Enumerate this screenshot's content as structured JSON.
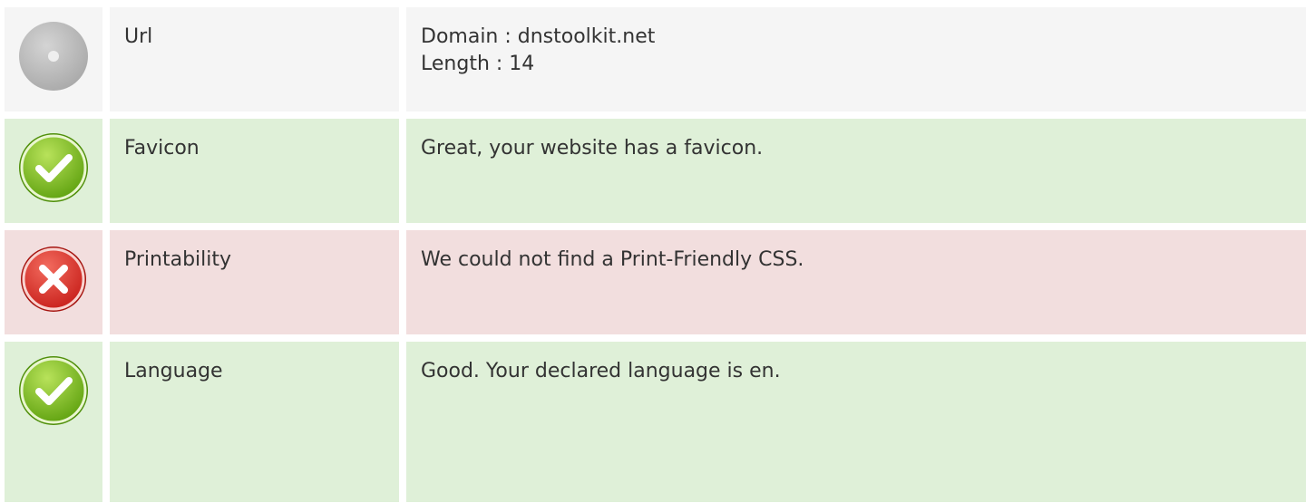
{
  "rows": [
    {
      "status": "neutral",
      "icon": "neutral-circle-icon",
      "label": "Url",
      "value_lines": [
        "Domain : dnstoolkit.net",
        "Length : 14"
      ]
    },
    {
      "status": "pass",
      "icon": "check-icon",
      "label": "Favicon",
      "value_lines": [
        "Great, your website has a favicon."
      ]
    },
    {
      "status": "fail",
      "icon": "cross-icon",
      "label": "Printability",
      "value_lines": [
        "We could not find a Print-Friendly CSS."
      ]
    },
    {
      "status": "pass",
      "icon": "check-icon",
      "label": "Language",
      "value_lines": [
        "Good. Your declared language is en."
      ]
    }
  ],
  "colors": {
    "neutral_bg": "#f5f5f5",
    "pass_bg": "#dff0d8",
    "fail_bg": "#f2dede",
    "pass_icon": "#7cc41f",
    "fail_icon": "#e0302c",
    "neutral_icon": "#bdbdbd",
    "text": "#333333"
  }
}
